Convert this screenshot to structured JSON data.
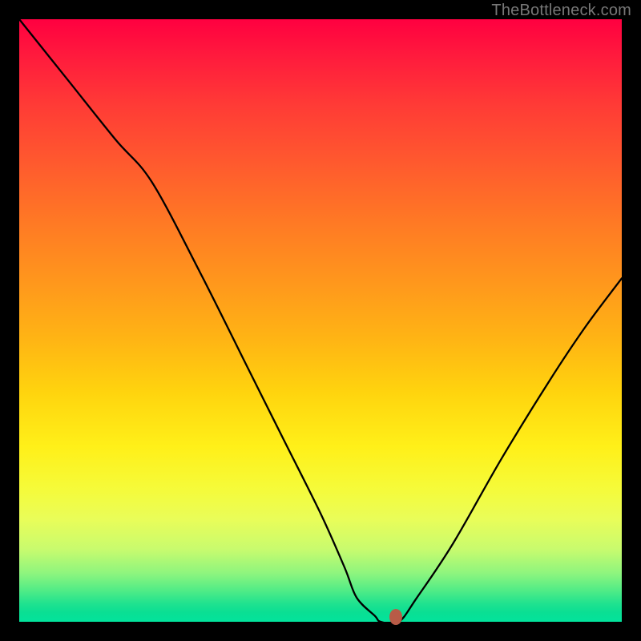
{
  "source_label": "TheBottleneck.com",
  "chart_data": {
    "type": "line",
    "title": "",
    "xlabel": "",
    "ylabel": "",
    "xlim": [
      0,
      100
    ],
    "ylim": [
      0,
      100
    ],
    "series": [
      {
        "name": "bottleneck-curve",
        "x": [
          0,
          8,
          16,
          22,
          30,
          38,
          44,
          50,
          54,
          56,
          59,
          60,
          63,
          66,
          72,
          80,
          88,
          94,
          100
        ],
        "y": [
          100,
          90,
          80,
          73,
          58,
          42,
          30,
          18,
          9,
          4,
          1,
          0,
          0,
          4,
          13,
          27,
          40,
          49,
          57
        ]
      }
    ],
    "marker": {
      "x": 62.5,
      "y": 0,
      "name": "optimal-point"
    },
    "gradient_stops": [
      {
        "pos": 0,
        "color": "#ff0040"
      },
      {
        "pos": 50,
        "color": "#ffb414"
      },
      {
        "pos": 78,
        "color": "#f5fb3a"
      },
      {
        "pos": 100,
        "color": "#02e39c"
      }
    ]
  }
}
